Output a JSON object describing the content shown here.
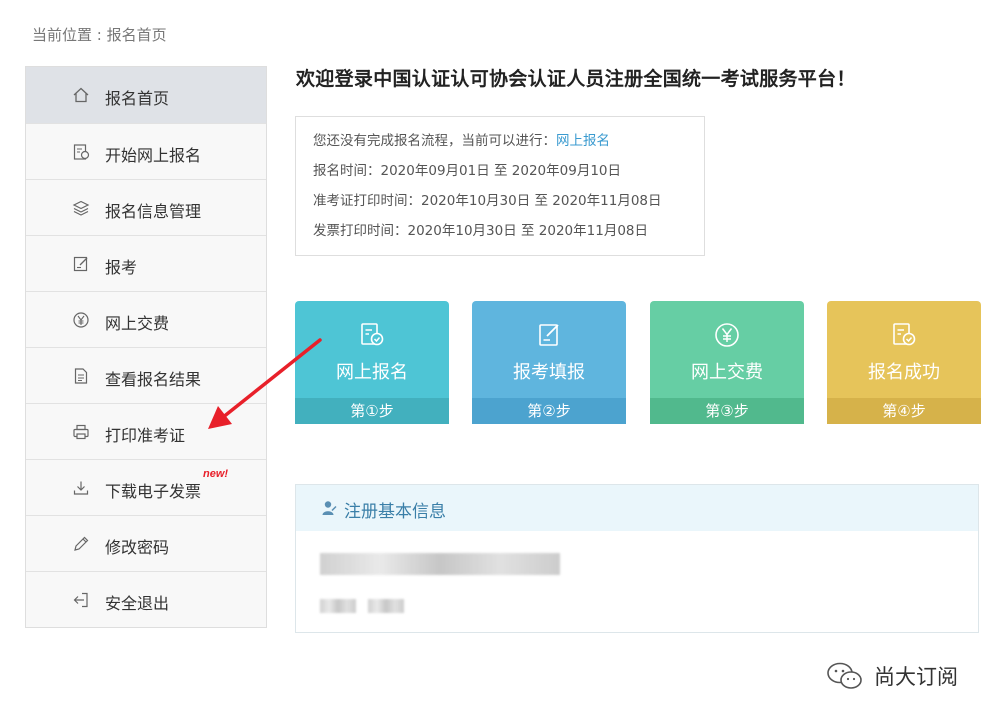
{
  "breadcrumb": "当前位置 : 报名首页",
  "sidebar": {
    "items": [
      {
        "label": "报名首页",
        "icon": "home-icon"
      },
      {
        "label": "开始网上报名",
        "icon": "register-doc-icon"
      },
      {
        "label": "报名信息管理",
        "icon": "layers-icon"
      },
      {
        "label": "报考",
        "icon": "edit-doc-icon"
      },
      {
        "label": "网上交费",
        "icon": "yen-icon"
      },
      {
        "label": "查看报名结果",
        "icon": "document-icon"
      },
      {
        "label": "打印准考证",
        "icon": "printer-icon"
      },
      {
        "label": "下载电子发票",
        "icon": "download-icon"
      },
      {
        "label": "修改密码",
        "icon": "pencil-icon"
      },
      {
        "label": "安全退出",
        "icon": "logout-icon"
      }
    ],
    "new_badge": "new!"
  },
  "welcome_title": "欢迎登录中国认证认可协会认证人员注册全国统一考试服务平台！",
  "notice": {
    "line1_prefix": "您还没有完成报名流程，当前可以进行：",
    "line1_link": "网上报名",
    "line2": "报名时间：2020年09月01日 至 2020年09月10日",
    "line3": "准考证打印时间：2020年10月30日 至 2020年11月08日",
    "line4": "发票打印时间：2020年10月30日 至 2020年11月08日"
  },
  "steps": [
    {
      "title": "网上报名",
      "step": "第①步",
      "color_top": "#4ec5d5",
      "color_bottom": "#42b0be",
      "icon": "register-doc-icon"
    },
    {
      "title": "报考填报",
      "step": "第②步",
      "color_top": "#5fb5de",
      "color_bottom": "#4ca3cf",
      "icon": "edit-doc-icon"
    },
    {
      "title": "网上交费",
      "step": "第③步",
      "color_top": "#66cea4",
      "color_bottom": "#51b98d",
      "icon": "yen-icon"
    },
    {
      "title": "报名成功",
      "step": "第④步",
      "color_top": "#e6c45a",
      "color_bottom": "#d6b24a",
      "icon": "register-doc-icon"
    }
  ],
  "info_panel": {
    "title": "注册基本信息",
    "icon": "user-icon"
  },
  "watermark": {
    "text": "尚大订阅",
    "icon": "wechat-icon"
  }
}
